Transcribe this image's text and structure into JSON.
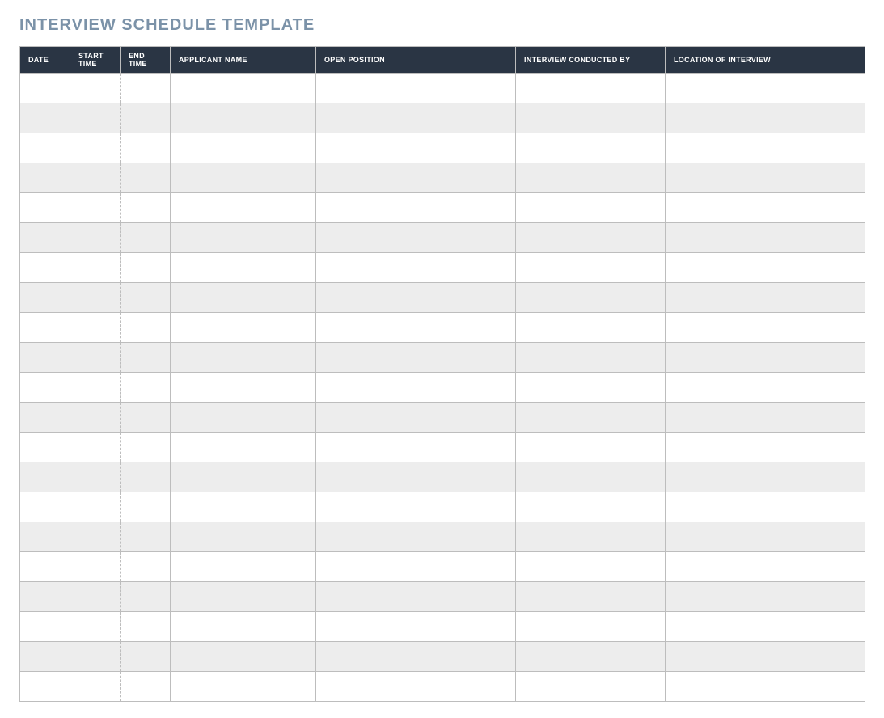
{
  "title": "INTERVIEW SCHEDULE TEMPLATE",
  "columns": {
    "date": "DATE",
    "start_time": "START TIME",
    "end_time": "END TIME",
    "applicant_name": "APPLICANT NAME",
    "open_position": "OPEN POSITION",
    "interview_conducted_by": "INTERVIEW CONDUCTED BY",
    "location_of_interview": "LOCATION OF INTERVIEW"
  },
  "rows": [
    {
      "date": "",
      "start_time": "",
      "end_time": "",
      "applicant_name": "",
      "open_position": "",
      "interview_conducted_by": "",
      "location_of_interview": ""
    },
    {
      "date": "",
      "start_time": "",
      "end_time": "",
      "applicant_name": "",
      "open_position": "",
      "interview_conducted_by": "",
      "location_of_interview": ""
    },
    {
      "date": "",
      "start_time": "",
      "end_time": "",
      "applicant_name": "",
      "open_position": "",
      "interview_conducted_by": "",
      "location_of_interview": ""
    },
    {
      "date": "",
      "start_time": "",
      "end_time": "",
      "applicant_name": "",
      "open_position": "",
      "interview_conducted_by": "",
      "location_of_interview": ""
    },
    {
      "date": "",
      "start_time": "",
      "end_time": "",
      "applicant_name": "",
      "open_position": "",
      "interview_conducted_by": "",
      "location_of_interview": ""
    },
    {
      "date": "",
      "start_time": "",
      "end_time": "",
      "applicant_name": "",
      "open_position": "",
      "interview_conducted_by": "",
      "location_of_interview": ""
    },
    {
      "date": "",
      "start_time": "",
      "end_time": "",
      "applicant_name": "",
      "open_position": "",
      "interview_conducted_by": "",
      "location_of_interview": ""
    },
    {
      "date": "",
      "start_time": "",
      "end_time": "",
      "applicant_name": "",
      "open_position": "",
      "interview_conducted_by": "",
      "location_of_interview": ""
    },
    {
      "date": "",
      "start_time": "",
      "end_time": "",
      "applicant_name": "",
      "open_position": "",
      "interview_conducted_by": "",
      "location_of_interview": ""
    },
    {
      "date": "",
      "start_time": "",
      "end_time": "",
      "applicant_name": "",
      "open_position": "",
      "interview_conducted_by": "",
      "location_of_interview": ""
    },
    {
      "date": "",
      "start_time": "",
      "end_time": "",
      "applicant_name": "",
      "open_position": "",
      "interview_conducted_by": "",
      "location_of_interview": ""
    },
    {
      "date": "",
      "start_time": "",
      "end_time": "",
      "applicant_name": "",
      "open_position": "",
      "interview_conducted_by": "",
      "location_of_interview": ""
    },
    {
      "date": "",
      "start_time": "",
      "end_time": "",
      "applicant_name": "",
      "open_position": "",
      "interview_conducted_by": "",
      "location_of_interview": ""
    },
    {
      "date": "",
      "start_time": "",
      "end_time": "",
      "applicant_name": "",
      "open_position": "",
      "interview_conducted_by": "",
      "location_of_interview": ""
    },
    {
      "date": "",
      "start_time": "",
      "end_time": "",
      "applicant_name": "",
      "open_position": "",
      "interview_conducted_by": "",
      "location_of_interview": ""
    },
    {
      "date": "",
      "start_time": "",
      "end_time": "",
      "applicant_name": "",
      "open_position": "",
      "interview_conducted_by": "",
      "location_of_interview": ""
    },
    {
      "date": "",
      "start_time": "",
      "end_time": "",
      "applicant_name": "",
      "open_position": "",
      "interview_conducted_by": "",
      "location_of_interview": ""
    },
    {
      "date": "",
      "start_time": "",
      "end_time": "",
      "applicant_name": "",
      "open_position": "",
      "interview_conducted_by": "",
      "location_of_interview": ""
    },
    {
      "date": "",
      "start_time": "",
      "end_time": "",
      "applicant_name": "",
      "open_position": "",
      "interview_conducted_by": "",
      "location_of_interview": ""
    },
    {
      "date": "",
      "start_time": "",
      "end_time": "",
      "applicant_name": "",
      "open_position": "",
      "interview_conducted_by": "",
      "location_of_interview": ""
    },
    {
      "date": "",
      "start_time": "",
      "end_time": "",
      "applicant_name": "",
      "open_position": "",
      "interview_conducted_by": "",
      "location_of_interview": ""
    }
  ]
}
